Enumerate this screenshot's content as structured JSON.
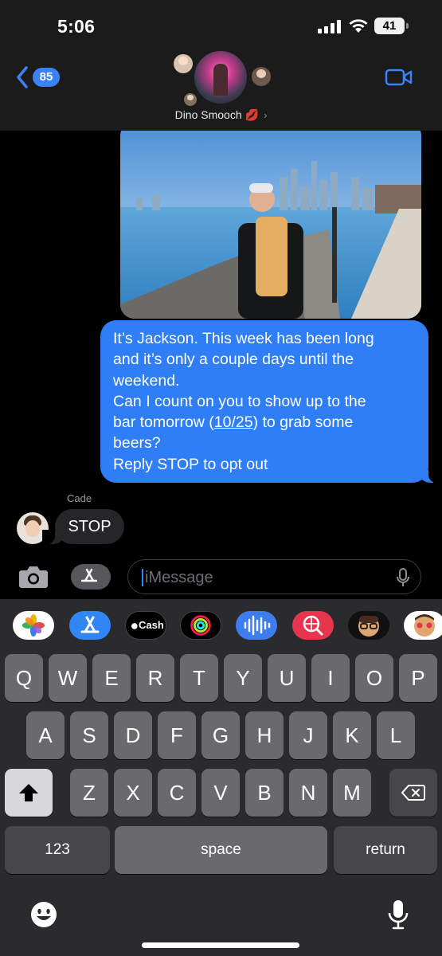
{
  "status_bar": {
    "time": "5:06",
    "battery": "41"
  },
  "header": {
    "back_count": "85",
    "group_name": "Dino Smooch",
    "name_emoji": "💋",
    "icons": {
      "back": "chevron-left-icon",
      "video": "video-camera-icon",
      "details": "chevron-right-icon"
    }
  },
  "thread": {
    "outgoing": {
      "lines": [
        "It’s Jackson. This week has been long",
        "and it’s only a couple days until the",
        "weekend.",
        "Can I count on you to show up to the"
      ],
      "line5_prefix": "bar tomorrow (",
      "line5_link": "10/25",
      "line5_suffix": ") to grab some",
      "line6": "beers?",
      "line7": "Reply STOP to opt out"
    },
    "incoming": {
      "sender": "Cade",
      "text": "STOP"
    }
  },
  "composer": {
    "placeholder": "iMessage",
    "icons": {
      "camera": "camera-icon",
      "apps": "app-store-icon",
      "dictation": "microphone-icon"
    }
  },
  "app_tray": [
    {
      "name": "Photos"
    },
    {
      "name": "App Store"
    },
    {
      "name": "Cash",
      "label": "Cash"
    },
    {
      "name": "Fitness"
    },
    {
      "name": "Audio Message"
    },
    {
      "name": "Images"
    },
    {
      "name": "Memoji"
    },
    {
      "name": "Memoji Stickers"
    }
  ],
  "keyboard": {
    "row1": [
      "Q",
      "W",
      "E",
      "R",
      "T",
      "Y",
      "U",
      "I",
      "O",
      "P"
    ],
    "row2": [
      "A",
      "S",
      "D",
      "F",
      "G",
      "H",
      "J",
      "K",
      "L"
    ],
    "row3": [
      "Z",
      "X",
      "C",
      "V",
      "B",
      "N",
      "M"
    ],
    "numbers_label": "123",
    "space_label": "space",
    "return_label": "return",
    "icons": {
      "shift": "shift-icon",
      "delete": "delete-icon",
      "emoji": "emoji-icon",
      "dictation": "microphone-icon"
    }
  },
  "colors": {
    "outgoing_bubble": "#2f7ef6",
    "incoming_bubble": "#262629",
    "accent": "#3b82f6"
  }
}
